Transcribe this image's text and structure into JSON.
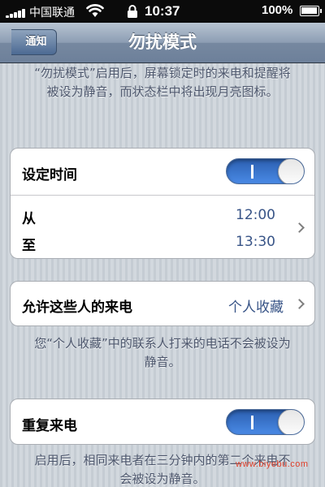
{
  "status_bar": {
    "carrier": "中国联通",
    "time": "10:37",
    "battery_percent": "100%",
    "battery_level": 1.0,
    "signal_bars": 5
  },
  "nav": {
    "back_label": "通知",
    "title": "勿扰模式"
  },
  "description": "“勿扰模式”启用后，屏幕锁定时的来电和提醒将被设为静音，而状态栏中将出现月亮图标。",
  "schedule": {
    "label": "设定时间",
    "enabled": true,
    "from_label": "从",
    "from_time": "12:00",
    "to_label": "至",
    "to_time": "13:30"
  },
  "allow_calls": {
    "label": "允许这些人的来电",
    "value": "个人收藏",
    "note": "您“个人收藏”中的联系人打来的电话不会被设为静音。"
  },
  "repeated_calls": {
    "label": "重复来电",
    "enabled": true,
    "note": "启用后，相同来电者在三分钟内的第二个来电不会被设为静音。"
  },
  "watermark": "www.biyebu.com",
  "colors": {
    "nav_bar": "#7688a0",
    "toggle_on": "#3b78d8",
    "value_text": "#385487",
    "note_text": "#4c566c"
  }
}
